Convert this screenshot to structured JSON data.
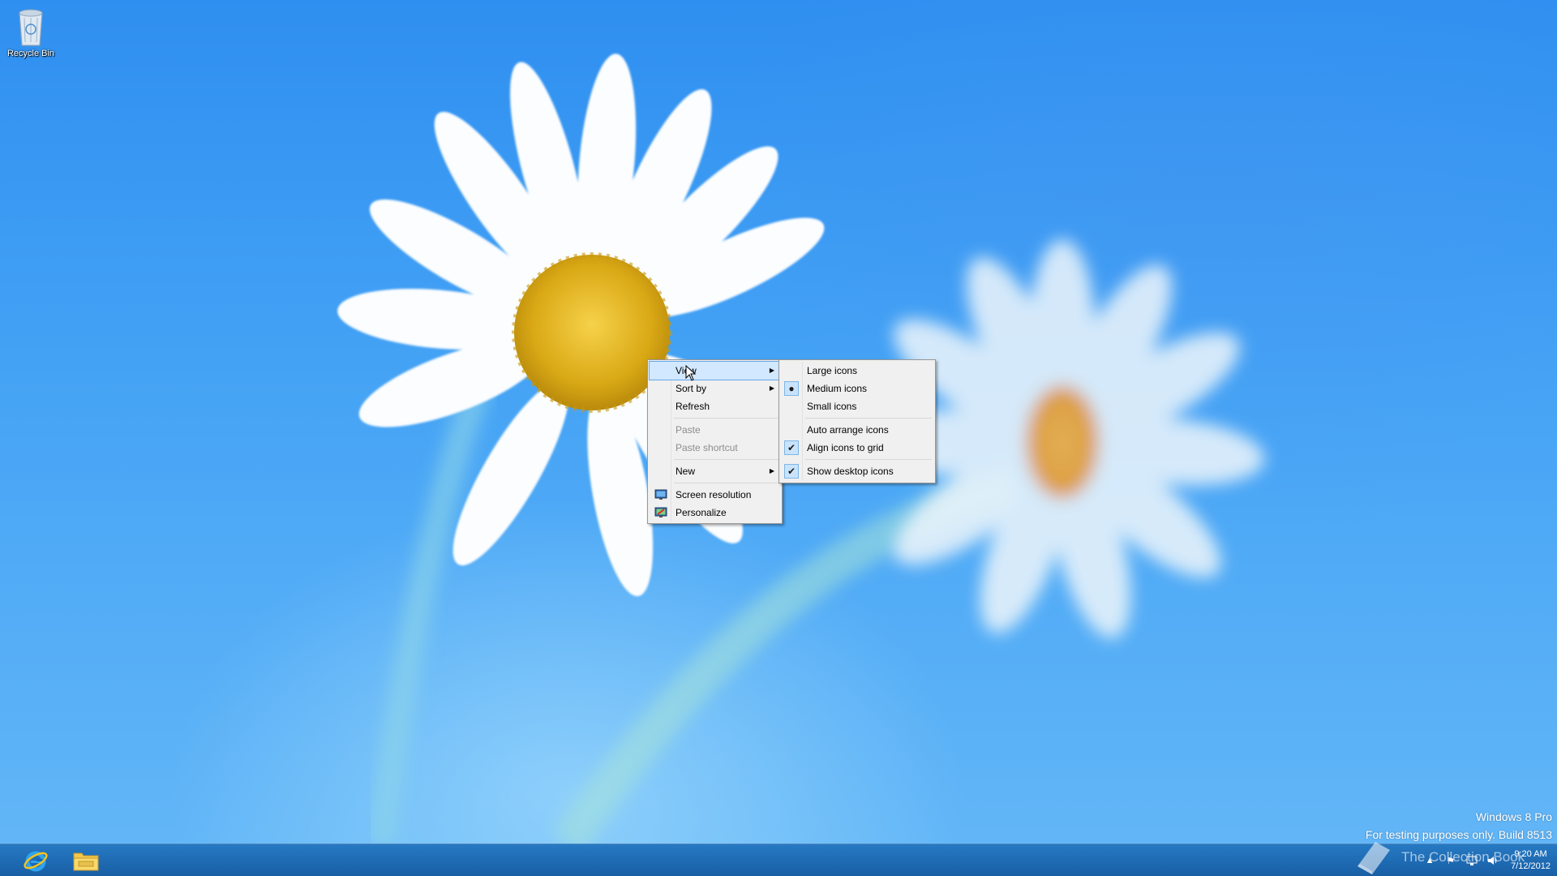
{
  "desktop": {
    "recycle_bin_label": "Recycle Bin",
    "watermark": {
      "line1": "Windows 8 Pro",
      "line2": "For testing purposes only. Build 8513"
    }
  },
  "context_menu": {
    "view": "View",
    "sort_by": "Sort by",
    "refresh": "Refresh",
    "paste": "Paste",
    "paste_shortcut": "Paste shortcut",
    "new": "New",
    "screen_resolution": "Screen resolution",
    "personalize": "Personalize"
  },
  "view_submenu": {
    "large_icons": "Large icons",
    "medium_icons": "Medium icons",
    "small_icons": "Small icons",
    "auto_arrange_icons": "Auto arrange icons",
    "align_icons_to_grid": "Align icons to grid",
    "show_desktop_icons": "Show desktop icons"
  },
  "taskbar": {
    "pinned": [
      "internet-explorer",
      "file-explorer"
    ],
    "tray_icons": [
      "up-arrow-icon",
      "flag-icon",
      "network-icon",
      "volume-icon"
    ],
    "clock": {
      "time": "9:20 AM",
      "date": "7/12/2012"
    }
  },
  "overlay_text": "The Collection Book",
  "colors": {
    "desktop_blue": "#2f8ff0",
    "taskbar": "#146ebe",
    "menu_bg": "#f0f0f0",
    "menu_highlight": "#d1e8ff"
  }
}
